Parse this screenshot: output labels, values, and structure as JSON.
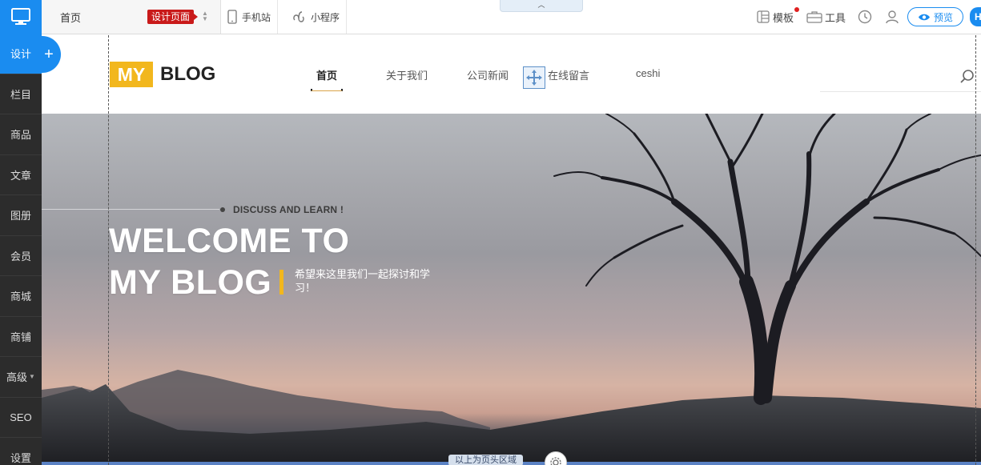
{
  "sidebar": {
    "logo_icon": "monitor-icon",
    "items": [
      {
        "label": "设计",
        "active": true
      },
      {
        "label": "栏目"
      },
      {
        "label": "商品"
      },
      {
        "label": "文章"
      },
      {
        "label": "图册"
      },
      {
        "label": "会员"
      },
      {
        "label": "商城"
      },
      {
        "label": "商铺"
      },
      {
        "label": "高级",
        "has_caret": true
      },
      {
        "label": "SEO"
      },
      {
        "label": "设置"
      }
    ],
    "add_label": "+"
  },
  "toolbar": {
    "page_name": "首页",
    "page_tag": "设计页面",
    "mobile_label": "手机站",
    "miniapp_label": "小程序",
    "collapse_icon": "chevron-up-icon",
    "template_label": "模板",
    "tools_label": "工具",
    "preview_label": "预览",
    "publish_label": "H"
  },
  "site": {
    "logo_my": "MY",
    "logo_blog": "BLOG",
    "nav": [
      "首页",
      "关于我们",
      "公司新闻",
      "在线留言",
      "ceshi"
    ],
    "active_nav": 0
  },
  "hero": {
    "discuss": "DISCUSS AND LEARN !",
    "welcome_line1": "WELCOME TO",
    "welcome_line2": "MY BLOG",
    "tagline": "希望来这里我们一起探讨和学习！"
  },
  "region": {
    "label": "以上为页头区域"
  },
  "colors": {
    "accent": "#1a8cf0",
    "sidebar_bg": "#2c2c2c",
    "logo_yellow": "#f2b71d",
    "tag_red": "#c91a1a"
  }
}
